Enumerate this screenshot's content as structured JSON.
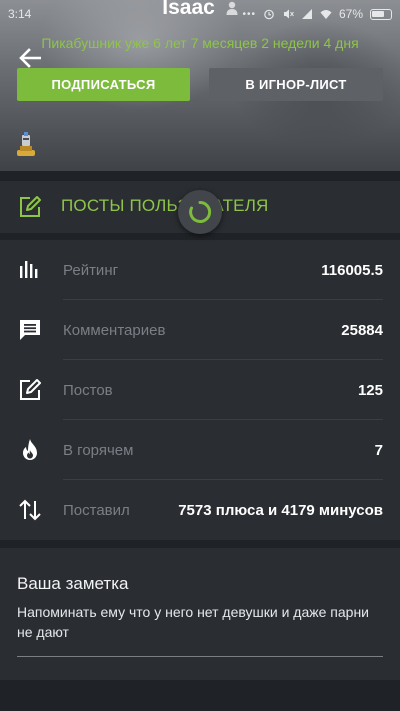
{
  "status_bar": {
    "time": "3:14",
    "battery": "67%"
  },
  "profile": {
    "username": "Isaac",
    "tenure": "Пикабушник уже 6 лет 7 месяцев 2 недели 4 дня"
  },
  "buttons": {
    "subscribe": "ПОДПИСАТЬСЯ",
    "ignore": "В ИГНОР-ЛИСТ"
  },
  "posts_link": {
    "label": "ПОСТЫ ПОЛЬЗОВАТЕЛЯ"
  },
  "stats": [
    {
      "icon": "bar-chart-icon",
      "label": "Рейтинг",
      "value": "116005.5"
    },
    {
      "icon": "comment-icon",
      "label": "Комментариев",
      "value": "25884"
    },
    {
      "icon": "edit-icon",
      "label": "Постов",
      "value": "125"
    },
    {
      "icon": "flame-icon",
      "label": "В горячем",
      "value": "7"
    },
    {
      "icon": "up-down-arrows-icon",
      "label": "Поставил",
      "value": "7573 плюса и 4179 минусов"
    }
  ],
  "note": {
    "title": "Ваша заметка",
    "text": "Напоминать ему что у него нет девушки и даже парни не дают"
  },
  "colors": {
    "accent_green": "#7dbb3c",
    "text_green": "#8ec549",
    "card": "#2a2d31",
    "background": "#1f2226"
  }
}
